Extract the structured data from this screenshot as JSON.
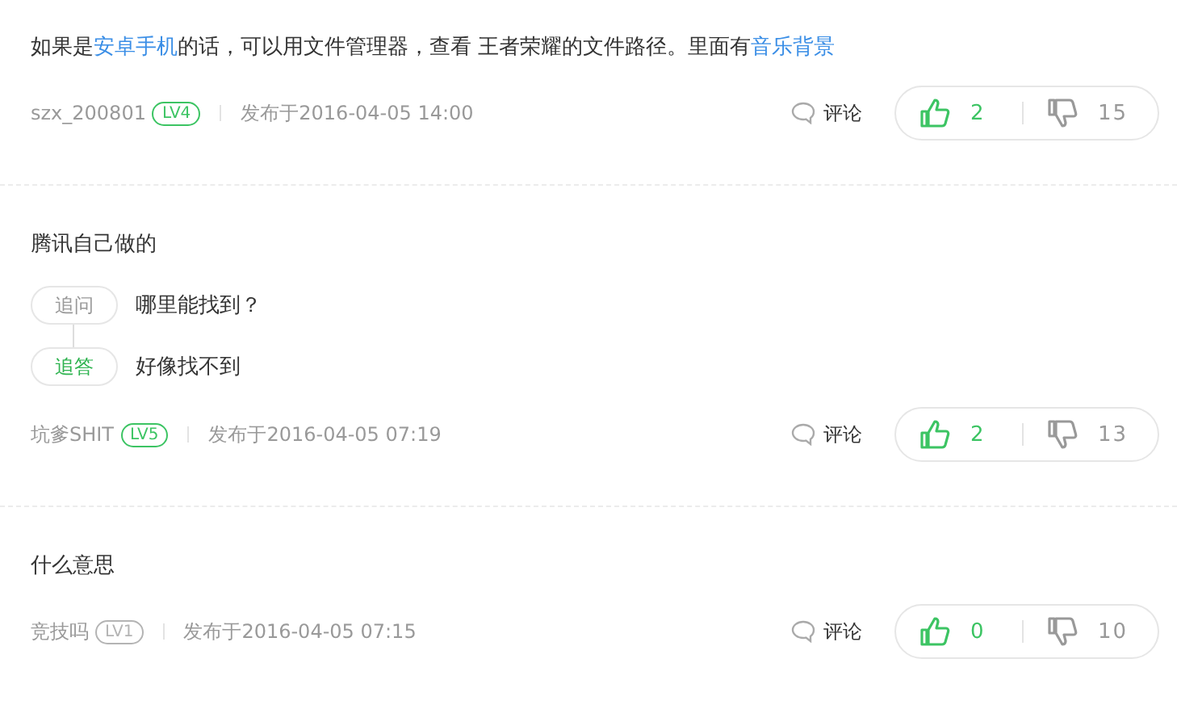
{
  "comments": [
    {
      "parts": [
        {
          "kind": "plain",
          "text": "如果是"
        },
        {
          "kind": "link",
          "text": "安卓手机"
        },
        {
          "kind": "plain",
          "text": "的话，可以用文件管理器，查看 王者荣耀的文件路径。里面有"
        },
        {
          "kind": "link",
          "text": "音乐背景"
        }
      ],
      "user": "szx_200801",
      "badge": {
        "text": "LV4",
        "color": "#3cc463"
      },
      "date": "发布于2016-04-05 14:00",
      "reply_label": "评论",
      "likes": "2",
      "dislikes": "15"
    },
    {
      "parts": [
        {
          "kind": "plain",
          "text": "腾讯自己做的"
        }
      ],
      "followups": [
        {
          "kind": "question",
          "tag": "追问",
          "text": "哪里能找到？"
        },
        {
          "kind": "answer",
          "tag": "追答",
          "text": "好像找不到"
        }
      ],
      "user": "坑爹SHIT",
      "badge": {
        "text": "LV5",
        "color": "#3cc463"
      },
      "date": "发布于2016-04-05 07:19",
      "reply_label": "评论",
      "likes": "2",
      "dislikes": "13"
    },
    {
      "parts": [
        {
          "kind": "plain",
          "text": "什么意思"
        }
      ],
      "user": "竞技吗",
      "badge": {
        "text": "LV1",
        "color": "#b4b4b4"
      },
      "date": "发布于2016-04-05 07:15",
      "reply_label": "评论",
      "likes": "0",
      "dislikes": "10"
    }
  ]
}
